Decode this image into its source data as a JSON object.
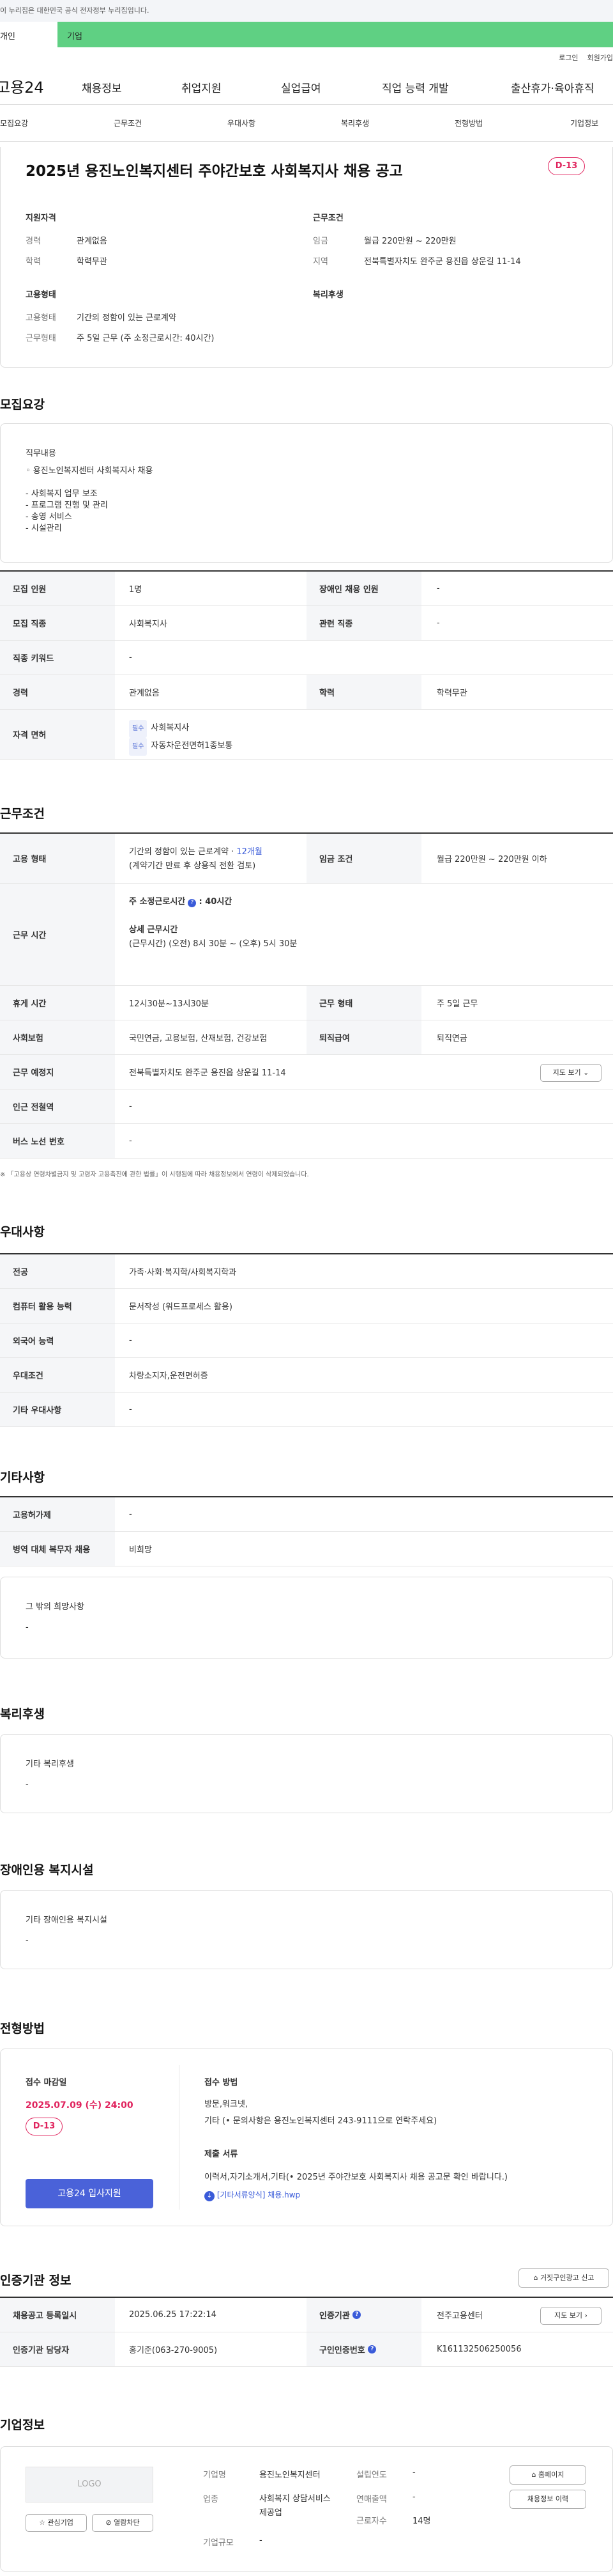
{
  "topbar": {
    "gov_notice": "이 누리집은 대한민국 공식 전자정부 누리집입니다."
  },
  "tabs": {
    "personal": "개인",
    "company": "기업"
  },
  "util": {
    "login": "로그인",
    "join": "회원가입"
  },
  "gnb": {
    "logo": "고용24",
    "menu": [
      "채용정보",
      "취업지원",
      "실업급여",
      "직업 능력 개발",
      "출산휴가·육아휴직"
    ]
  },
  "anchors": [
    "모집요강",
    "근무조건",
    "우대사항",
    "복리후생",
    "전형방법",
    "기업정보"
  ],
  "header": {
    "title": "2025년 용진노인복지센터 주야간보호 사회복지사 채용 공고",
    "dday": "D-13",
    "qual_title": "지원자격",
    "career_k": "경력",
    "career_v": "관계없음",
    "edu_k": "학력",
    "edu_v": "학력무관",
    "cond_title": "근무조건",
    "wage_k": "임금",
    "wage_v": "월급 220만원 ~ 220만원",
    "area_k": "지역",
    "area_v": "전북특별자치도 완주군 용진읍 상운길 11-14",
    "emp_title": "고용형태",
    "type_k": "고용형태",
    "type_v": "기간의 정함이 있는 근로계약",
    "form_k": "근무형태",
    "form_v": "주 5일 근무 (주 소정근로시간: 40시간)",
    "welfare_title": "복리후생"
  },
  "recruit": {
    "heading": "모집요강",
    "duty_title": "직무내용",
    "duty_lines": [
      "◦ 용진노인복지센터 사회복지사 채용",
      "",
      "- 사회복지 업무 보조",
      "- 프로그램 진행 및 관리",
      "- 송영 서비스",
      "- 시설관리"
    ],
    "headcount_k": "모집 인원",
    "headcount_v": "1명",
    "disabled_k": "장애인 채용 인원",
    "disabled_v": "-",
    "job_k": "모집 직종",
    "job_v": "사회복지사",
    "related_k": "관련 직종",
    "related_v": "-",
    "keyword_k": "직종 키워드",
    "keyword_v": "-",
    "career_k": "경력",
    "career_v": "관계없음",
    "edu_k": "학력",
    "edu_v": "학력무관",
    "license_k": "자격 면허",
    "license_tag": "필수",
    "licenses": [
      "사회복지사",
      "자동차운전면허1종보통"
    ]
  },
  "conditions": {
    "heading": "근무조건",
    "type_k": "고용 형태",
    "type_v": "기간의 정함이 있는 근로계약 · ",
    "type_months": "12개월",
    "type_note": "(계약기간 만료 후 상용직 전환 검토)",
    "wage_k": "임금 조건",
    "wage_v": "월급 220만원 ~ 220만원 이하",
    "hours_k": "근무 시간",
    "weekly_label": "주 소정근로시간",
    "weekly_v": ": 40시간",
    "detail_label": "상세 근무시간",
    "detail_v": "(근무시간) (오전) 8시 30분 ~ (오후) 5시 30분",
    "break_k": "휴게 시간",
    "break_v": "12시30분~13시30분",
    "form_k": "근무 형태",
    "form_v": "주 5일 근무",
    "ins_k": "사회보험",
    "ins_v": "국민연금, 고용보험, 산재보험, 건강보험",
    "sev_k": "퇴직급여",
    "sev_v": "퇴직연금",
    "place_k": "근무 예정지",
    "place_v": "전북특별자치도 완주군 용진읍 상운길 11-14",
    "map_btn": "지도 보기",
    "subway_k": "인근 전철역",
    "subway_v": "-",
    "bus_k": "버스 노선 번호",
    "bus_v": "-",
    "footnote": "※ 「고용상 연령차별금지 및 고령자 고용촉진에 관한 법률」이 시행됨에 따라 채용정보에서 연령이 삭제되었습니다."
  },
  "prefer": {
    "heading": "우대사항",
    "major_k": "전공",
    "major_v": "가족·사회·복지학/사회복지학과",
    "pc_k": "컴퓨터 활용 능력",
    "pc_v": "문서작성 (워드프로세스 활용)",
    "lang_k": "외국어 능력",
    "lang_v": "-",
    "cond_k": "우대조건",
    "cond_v": "차량소지자,운전면허증",
    "etc_k": "기타 우대사항",
    "etc_v": "-"
  },
  "other": {
    "heading": "기타사항",
    "cap_k": "고용허가제",
    "cap_v": "-",
    "mil_k": "병역 대체 복무자 채용",
    "mil_v": "비희망",
    "wish_title": "그 밖의 희망사항",
    "wish_v": "-"
  },
  "welfare": {
    "heading": "복리후생",
    "sub": "기타 복리후생",
    "v": "-"
  },
  "disabled_fac": {
    "heading": "장애인용 복지시설",
    "sub": "기타 장애인용 복지시설",
    "v": "-"
  },
  "process": {
    "heading": "전형방법",
    "deadline_label": "접수 마감일",
    "deadline": "2025.07.09 (수) 24:00",
    "dday": "D-13",
    "apply_btn": "고용24 입사지원",
    "method_label": "접수 방법",
    "method_v": "방문,워크넷,",
    "method_etc": "기타 (• 문의사항은 용진노인복지센터 243-9111으로 연락주세요)",
    "docs_label": "제출 서류",
    "docs_v": "이력서,자기소개서,기타(• 2025년 주야간보호 사회복지사 채용 공고문 확인 바랍니다.)",
    "file": "[기타서류양식] 채용.hwp"
  },
  "cert": {
    "heading": "인증기관 정보",
    "report_btn": "거짓구인광고 신고",
    "reg_k": "채용공고 등록일시",
    "reg_v": "2025.06.25 17:22:14",
    "org_k": "인증기관",
    "org_v": "전주고용센터",
    "map_btn": "지도 보기",
    "staff_k": "인증기관 담당자",
    "staff_v": "홍기준(063-270-9005)",
    "id_k": "구인인증번호",
    "id_v": "K161132506250056"
  },
  "company": {
    "heading": "기업정보",
    "logo": "LOGO",
    "fav_btn": "관심기업",
    "block_btn": "열람차단",
    "name_k": "기업명",
    "name_v": "용진노인복지센터",
    "est_k": "설립연도",
    "est_v": "-",
    "ind_k": "업종",
    "ind_v": "사회복지 상담서비스 제공업",
    "rev_k": "연매출액",
    "rev_v": "-",
    "size_k": "기업규모",
    "size_v": "-",
    "emp_k": "근로자수",
    "emp_v": "14명",
    "home_btn": "홈페이지",
    "jobs_btn": "채용정보 이력"
  },
  "colors": {
    "accent_green": "#5fd083",
    "dday_red": "#e0245e",
    "button_blue": "#4a62d9"
  }
}
